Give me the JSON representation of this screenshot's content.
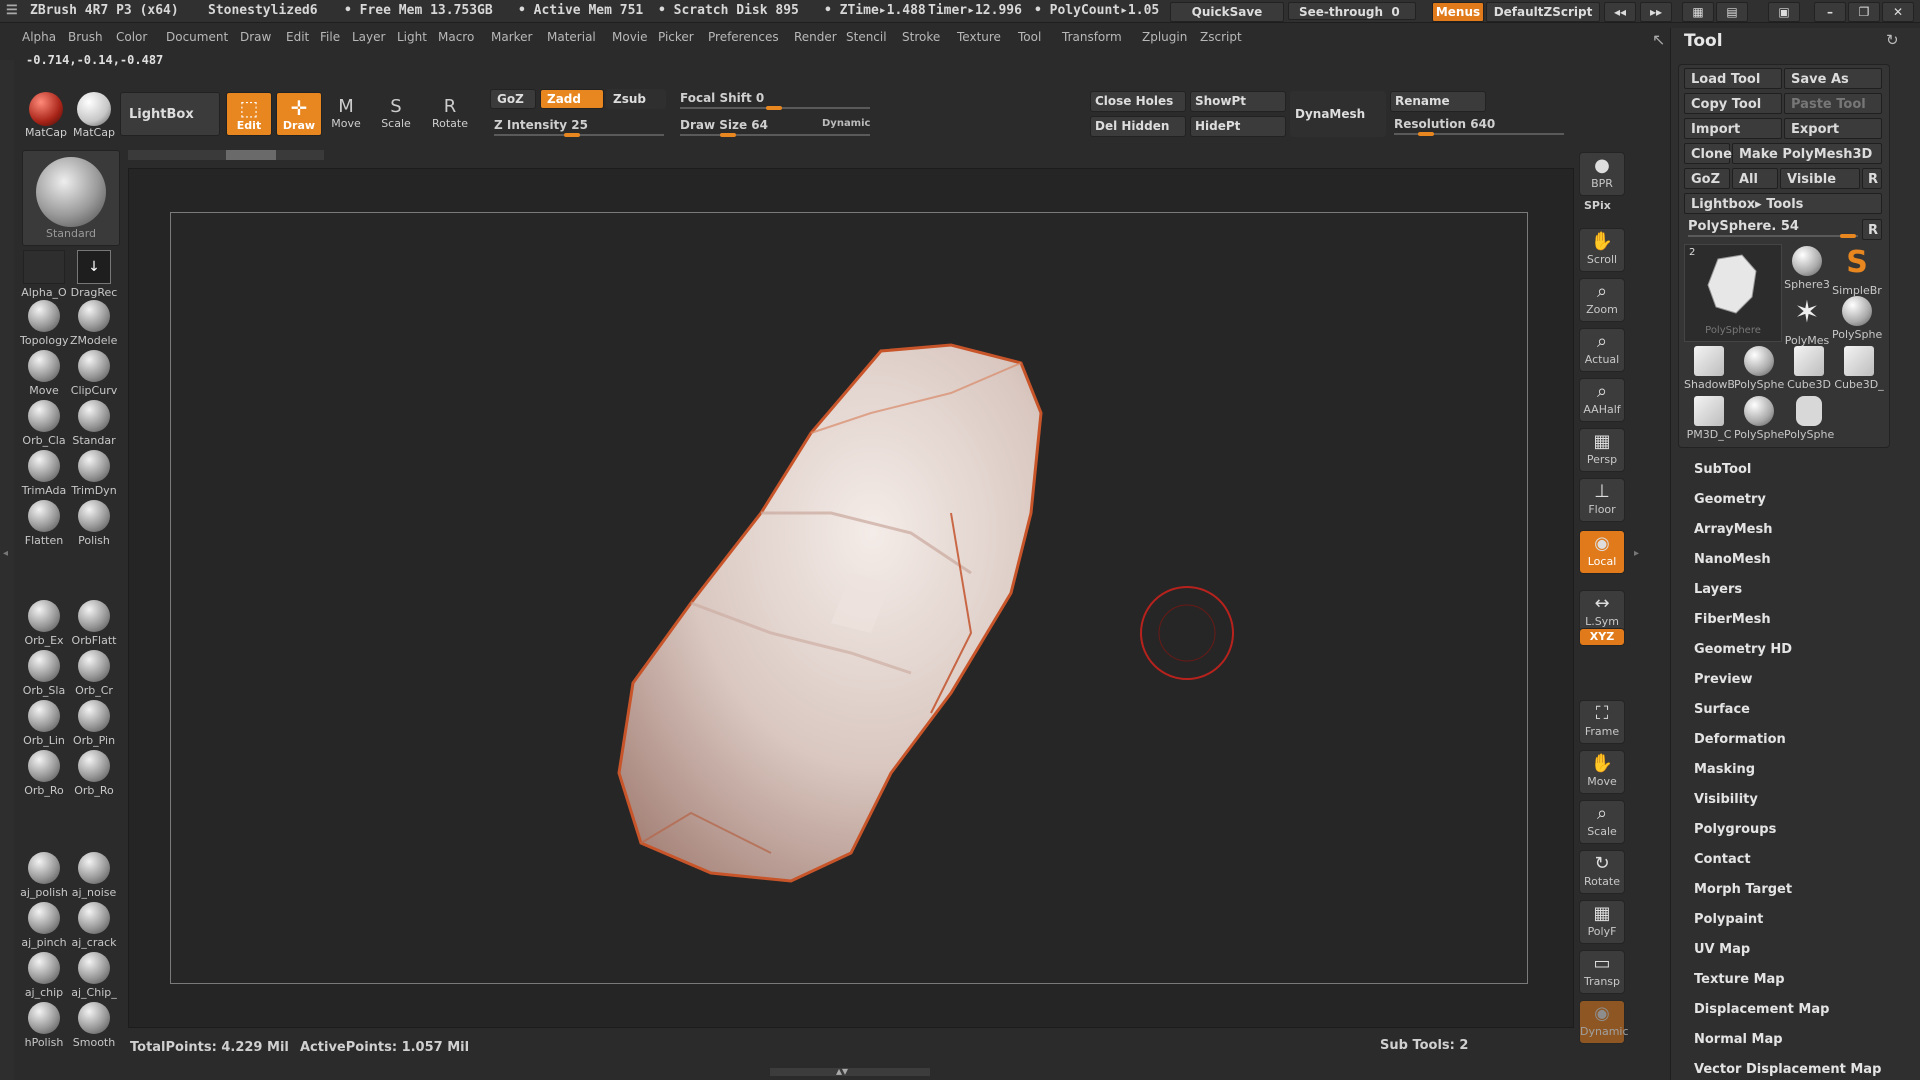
{
  "titlebar": {
    "app": "ZBrush 4R7 P3 (x64)",
    "doc": "Stonestylized6",
    "free_mem": "• Free Mem 13.753GB",
    "active_mem": "• Active Mem 751",
    "scratch": "• Scratch Disk 895",
    "ztime": "• ZTime▸1.488",
    "timer": "Timer▸12.996",
    "polycount": "• PolyCount▸1.05",
    "quicksave": "QuickSave",
    "seethrough": "See-through",
    "seethrough_val": "0",
    "menus": "Menus",
    "script": "DefaultZScript"
  },
  "menubar": [
    "Alpha",
    "Brush",
    "Color",
    "Document",
    "Draw",
    "Edit",
    "File",
    "Layer",
    "Light",
    "Macro",
    "Marker",
    "Material",
    "Movie",
    "Picker",
    "Preferences",
    "Render",
    "Stencil",
    "Stroke",
    "Texture",
    "Tool",
    "Transform",
    "Zplugin",
    "Zscript"
  ],
  "coords": "-0.714,-0.14,-0.487",
  "topshelf": {
    "matcap1": "MatCap",
    "matcap2": "MatCap",
    "lightbox": "LightBox",
    "edit": "Edit",
    "draw": "Draw",
    "move": "Move",
    "scale": "Scale",
    "rotate": "Rotate",
    "goz": "GoZ",
    "zadd": "Zadd",
    "zsub": "Zsub",
    "z_intensity": "Z Intensity 25",
    "focal_shift": "Focal Shift 0",
    "draw_size": "Draw Size 64",
    "dynamic": "Dynamic",
    "close_holes": "Close Holes",
    "showpt": "ShowPt",
    "del_hidden": "Del Hidden",
    "hidept": "HidePt",
    "dynamesh": "DynaMesh",
    "rename": "Rename",
    "resolution": "Resolution 640"
  },
  "left_panel": {
    "brush_big": "Standard",
    "alpha": "Alpha_O",
    "dragrect": "DragRec",
    "items": [
      "Topology",
      "ZModeler",
      "Move",
      "ClipCurv",
      "Orb_Cla",
      "Standar",
      "TrimAda",
      "TrimDyn",
      "Flatten",
      "Polish",
      "Orb_Ex",
      "OrbFlatt",
      "Orb_Sla",
      "Orb_Cr",
      "Orb_Lin",
      "Orb_Pin",
      "Orb_Ro",
      "Orb_Ro",
      "aj_polish",
      "aj_noise",
      "aj_pinch",
      "aj_crack",
      "aj_chip",
      "aj_Chip_",
      "hPolish",
      "Smooth"
    ]
  },
  "right_shelf": [
    "BPR",
    "SPix",
    "Scroll",
    "Zoom",
    "Actual",
    "AAHalf",
    "Persp",
    "Floor",
    "Local",
    "L.Sym",
    "XYZ",
    "Frame",
    "Move",
    "Scale",
    "Rotate",
    "PolyF",
    "Transp",
    "Dynamic"
  ],
  "tool_panel": {
    "title": "Tool",
    "load_tool": "Load Tool",
    "save_as": "Save As",
    "copy_tool": "Copy Tool",
    "paste_tool": "Paste Tool",
    "import": "Import",
    "export": "Export",
    "clone": "Clone",
    "make_polymesh": "Make PolyMesh3D",
    "goz": "GoZ",
    "all": "All",
    "visible": "Visible",
    "r": "R",
    "lightbox_tools": "Lightbox▸ Tools",
    "polysphere": "PolySphere. 54",
    "thumbs": [
      "PolySphere",
      "Sphere3",
      "SimpleBr",
      "PolyMes",
      "PolySphe",
      "ShadowB",
      "PolySphe",
      "Cube3D",
      "Cube3D_",
      "PM3D_C",
      "PolySphe",
      "PolySphe"
    ],
    "sections": [
      "SubTool",
      "Geometry",
      "ArrayMesh",
      "NanoMesh",
      "Layers",
      "FiberMesh",
      "Geometry HD",
      "Preview",
      "Surface",
      "Deformation",
      "Masking",
      "Visibility",
      "Polygroups",
      "Contact",
      "Morph Target",
      "Polypaint",
      "UV Map",
      "Texture Map",
      "Displacement Map",
      "Normal Map",
      "Vector Displacement Map"
    ]
  },
  "status": {
    "total_points": "TotalPoints: 4.229 Mil",
    "active_points": "ActivePoints: 1.057 Mil",
    "subtools": "Sub Tools: 2"
  }
}
